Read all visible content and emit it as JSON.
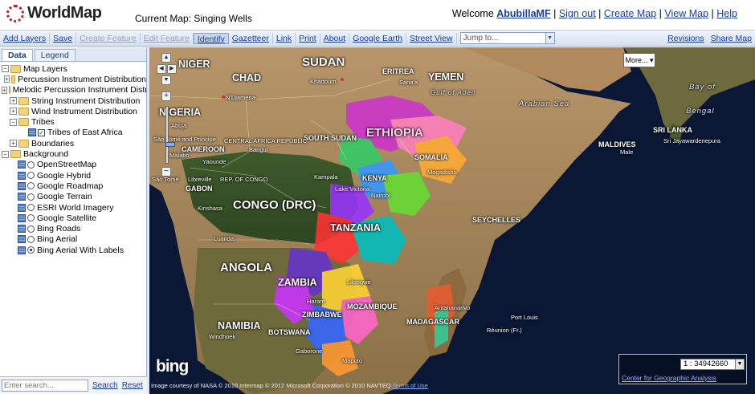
{
  "header": {
    "logo_text": "WorldMap",
    "current_map": "Current Map: Singing Wells",
    "welcome": "Welcome ",
    "username": "AbubillaMF",
    "sep": " | ",
    "links": [
      "Sign out",
      "Create Map",
      "View Map",
      "Help"
    ]
  },
  "toolbar": {
    "buttons": [
      "Add Layers",
      "Save",
      "Create Feature",
      "Edit Feature",
      "Identify",
      "Gazetteer",
      "Link",
      "Print",
      "About",
      "Google Earth",
      "Street View"
    ],
    "jump_placeholder": "Jump to...",
    "right_buttons": [
      "Revisions",
      "Share Map"
    ]
  },
  "left_panel": {
    "tabs": [
      "Data",
      "Legend"
    ],
    "tree": {
      "map_layers": "Map Layers",
      "layer_groups": [
        "Percussion Instrument Distribution",
        "Melodic Percussion Instrument Distribution",
        "String Instrument Distribution",
        "Wind Instrument Distribution"
      ],
      "tribes": "Tribes",
      "tribes_child": "Tribes of East Africa",
      "boundaries": "Boundaries",
      "background": "Background",
      "basemaps": [
        "OpenStreetMap",
        "Google Hybrid",
        "Google Roadmap",
        "Google Terrain",
        "ESRI World Imagery",
        "Google Satellite",
        "Bing Roads",
        "Bing Aerial",
        "Bing Aerial With Labels"
      ],
      "selected_basemap": "Bing Aerial With Labels"
    },
    "search": {
      "placeholder": "Enter search...",
      "search_label": "Search",
      "reset_label": "Reset"
    }
  },
  "map": {
    "more_button": "More...",
    "labels": {
      "sudan": "SUDAN",
      "chad": "CHAD",
      "niger": "NIGER",
      "yemen": "YEMEN",
      "eritrea": "ERITREA",
      "nigeria": "NIGERIA",
      "ethiopia": "ETHIOPIA",
      "somalia": "SOMALIA",
      "south_sudan": "SOUTH SUDAN",
      "car": "CENTRAL AFRICA REPUBLIC",
      "cameroon": "CAMEROON",
      "gabon": "GABON",
      "rep_congo": "REP. OF CONGO",
      "congo_drc": "CONGO (DRC)",
      "kenya": "KENYA",
      "tanzania": "TANZANIA",
      "angola": "ANGOLA",
      "zambia": "ZAMBIA",
      "zimbabwe": "ZIMBABWE",
      "mozambique": "MOZAMBIQUE",
      "madagascar": "MADAGASCAR",
      "namibia": "NAMIBIA",
      "botswana": "BOTSWANA",
      "sri_lanka": "SRI LANKA",
      "maldives": "MALDIVES",
      "seychelles": "SEYCHELLES",
      "bay_of_bengal_1": "Bay of",
      "bay_of_bengal_2": "Bengal",
      "arabian_sea": "Arabian Sea",
      "gulf_of_aden": "Gulf of Aden",
      "khartoum": "Khartoum",
      "ndjamena": "N'Djamena",
      "abuja": "Abuja",
      "bangui": "Bangui",
      "yaounde": "Yaounde",
      "libreville": "Libreville",
      "kinshasa": "Kinshasa",
      "luanda": "Luanda",
      "mogadishu": "Mogadishu",
      "kampala": "Kampala",
      "nairobi": "Nairobi",
      "lilongwe": "Lilongwe",
      "harare": "Harare",
      "maputo": "Maputo",
      "gaborone": "Gaborone",
      "windhoek": "Windhoek",
      "antananarivo": "Antananarivo",
      "port_louis": "Port Louis",
      "male": "Male",
      "colombo": "Sri Jayawardenepura",
      "sanaa": "Sana'a",
      "reunion": "Réunion (Fr.)",
      "sao_tome": "São Tomé",
      "sao_tome_2": "São Tomé and Príncipe",
      "lake_victoria": "Lake Victoria",
      "malabo": "Malabo"
    },
    "bing_logo": "bing",
    "attribution_text": "Image courtesy of NASA © 2010 Intermap © 2012 Microsoft Corporation © 2010 NAVTEQ",
    "terms_link": "Terms of Use",
    "scale_value": "1 : 34942660",
    "cga_link": "Center for Geographic Analysis"
  }
}
